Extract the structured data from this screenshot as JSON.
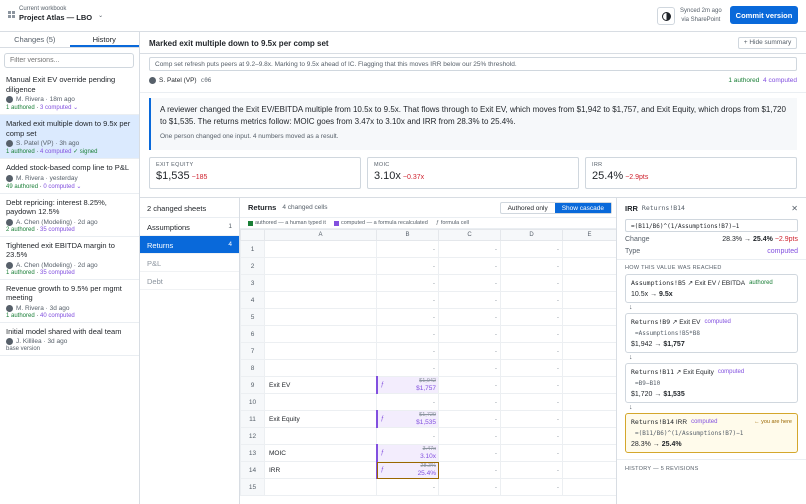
{
  "topbar": {
    "workbook_label": "Current workbook",
    "workbook_name": "Project Atlas — LBO",
    "sync_line1": "Synced 2m ago",
    "sync_line2": "via SharePoint",
    "commit_label": "Commit version"
  },
  "left": {
    "tabs": [
      "Changes (5)",
      "History"
    ],
    "filter_placeholder": "Filter versions...",
    "versions": [
      {
        "title": "Manual Exit EV override pending diligence",
        "author": "M. Rivera",
        "time": "18m ago",
        "authored": "1 authored",
        "computed": "3 computed",
        "signed": ""
      },
      {
        "title": "Marked exit multiple down to 9.5x per comp set",
        "author": "S. Patel (VP)",
        "time": "3h ago",
        "authored": "1 authored",
        "computed": "4 computed",
        "signed": "✓ signed"
      },
      {
        "title": "Added stock-based comp line to P&L",
        "author": "M. Rivera",
        "time": "yesterday",
        "authored": "49 authored",
        "computed": "0 computed",
        "signed": ""
      },
      {
        "title": "Debt repricing: interest 8.25%, paydown 12.5%",
        "author": "A. Chen (Modeling)",
        "time": "2d ago",
        "authored": "2 authored",
        "computed": "35 computed",
        "signed": ""
      },
      {
        "title": "Tightened exit EBITDA margin to 23.5%",
        "author": "A. Chen (Modeling)",
        "time": "2d ago",
        "authored": "1 authored",
        "computed": "35 computed",
        "signed": ""
      },
      {
        "title": "Revenue growth to 9.5% per mgmt meeting",
        "author": "M. Rivera",
        "time": "3d ago",
        "authored": "1 authored",
        "computed": "40 computed",
        "signed": ""
      },
      {
        "title": "Initial model shared with deal team",
        "author": "J. Killilea",
        "time": "3d ago",
        "base": "base version"
      }
    ]
  },
  "main": {
    "title": "Marked exit multiple down to 9.5x per comp set",
    "hide_label": "+ Hide summary",
    "note": "Comp set refresh puts peers at 9.2–9.8x. Marking to 9.5x ahead of IC. Flagging that this moves IRR below our 25% threshold.",
    "author": "S. Patel (VP)",
    "hash": "c06",
    "authored": "1 authored",
    "computed": "4 computed",
    "summary_text": "A reviewer changed the Exit EV/EBITDA multiple from 10.5x to 9.5x. That flows through to Exit EV, which moves from $1,942 to $1,757, and Exit Equity, which drops from $1,720 to $1,535. The returns metrics follow: MOIC goes from 3.47x to 3.10x and IRR from 28.3% to 25.4%.",
    "summary_sub": "One person changed one input. 4 numbers moved as a result.",
    "cards": [
      {
        "label": "EXIT EQUITY",
        "value": "$1,535",
        "delta": "−185"
      },
      {
        "label": "MOIC",
        "value": "3.10x",
        "delta": "−0.37x"
      },
      {
        "label": "IRR",
        "value": "25.4%",
        "delta": "−2.9pts"
      }
    ]
  },
  "sheets": {
    "header": "2 changed sheets",
    "items": [
      {
        "name": "Assumptions",
        "count": "1"
      },
      {
        "name": "Returns",
        "count": "4"
      },
      {
        "name": "P&L",
        "count": ""
      },
      {
        "name": "Debt",
        "count": ""
      }
    ]
  },
  "grid": {
    "sheet": "Returns",
    "changed": "4 changed cells",
    "authored_only": "Authored only",
    "show_cascade": "Show cascade",
    "legend": [
      "authored — a human typed it",
      "computed — a formula recalculated",
      "formula cell"
    ],
    "columns": [
      "A",
      "B",
      "C",
      "D",
      "E"
    ],
    "rows": [
      {
        "n": "1",
        "a": "",
        "b": "-",
        "c": "-",
        "d": "-"
      },
      {
        "n": "2",
        "a": "",
        "b": "-",
        "c": "-",
        "d": "-"
      },
      {
        "n": "3",
        "a": "",
        "b": "-",
        "c": "-",
        "d": "-"
      },
      {
        "n": "4",
        "a": "",
        "b": "-",
        "c": "-",
        "d": "-"
      },
      {
        "n": "5",
        "a": "",
        "b": "-",
        "c": "-",
        "d": "-"
      },
      {
        "n": "6",
        "a": "",
        "b": "-",
        "c": "-",
        "d": "-"
      },
      {
        "n": "7",
        "a": "",
        "b": "-",
        "c": "-",
        "d": "-"
      },
      {
        "n": "8",
        "a": "",
        "b": "-",
        "c": "-",
        "d": "-"
      },
      {
        "n": "9",
        "a": "Exit EV",
        "old": "$1,942",
        "new": "$1,757",
        "c": "-",
        "d": "-"
      },
      {
        "n": "10",
        "a": "",
        "b": "-",
        "c": "-",
        "d": "-"
      },
      {
        "n": "11",
        "a": "Exit Equity",
        "old": "$1,720",
        "new": "$1,535",
        "c": "-",
        "d": "-"
      },
      {
        "n": "12",
        "a": "",
        "b": "-",
        "c": "-",
        "d": "-"
      },
      {
        "n": "13",
        "a": "MOIC",
        "old": "3.47x",
        "new": "3.10x",
        "c": "-",
        "d": "-"
      },
      {
        "n": "14",
        "a": "IRR",
        "old": "28.3%",
        "new": "25.4%",
        "c": "-",
        "d": "-"
      },
      {
        "n": "15",
        "a": "",
        "b": "-",
        "c": "-",
        "d": "-"
      }
    ]
  },
  "inspector": {
    "name": "IRR",
    "ref": "Returns!B14",
    "formula": "=(B11/B6)^(1/Assumptions!B7)−1",
    "change_label": "Change",
    "change_from": "28.3% →",
    "change_to": "25.4%",
    "change_delta": "−2.9pts",
    "type_label": "Type",
    "type_value": "computed",
    "how_label": "HOW THIS VALUE WAS REACHED",
    "steps": [
      {
        "ref": "Assumptions!B5",
        "name": "Exit EV / EBITDA",
        "badge": "authored",
        "formula": "",
        "from": "10.5x →",
        "to": "9.5x"
      },
      {
        "ref": "Returns!B9",
        "name": "Exit EV",
        "badge": "computed",
        "formula": "=Assumptions!B5*B8",
        "from": "$1,942 →",
        "to": "$1,757"
      },
      {
        "ref": "Returns!B11",
        "name": "Exit Equity",
        "badge": "computed",
        "formula": "=B9−B10",
        "from": "$1,720 →",
        "to": "$1,535"
      },
      {
        "ref": "Returns!B14",
        "name": "IRR",
        "badge": "computed",
        "formula": "=(B11/B6)^(1/Assumptions!B7)−1",
        "from": "28.3% →",
        "to": "25.4%",
        "here": "← you are here"
      }
    ],
    "history_label": "HISTORY — 5 REVISIONS"
  },
  "colors": {
    "accent": "#0969da",
    "authored": "#1a7f37",
    "computed": "#8250df",
    "negative": "#cf222e"
  }
}
